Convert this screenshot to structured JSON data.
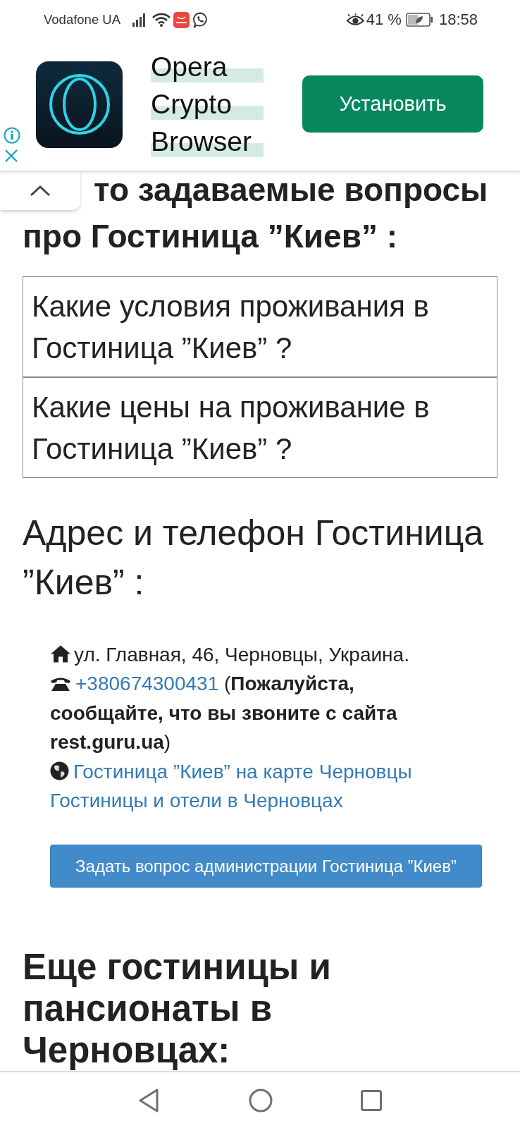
{
  "status_bar": {
    "carrier": "Vodafone UA",
    "battery": "41 %",
    "time": "18:58"
  },
  "ad": {
    "app_name": "Opera Crypto Browser",
    "install": "Установить"
  },
  "faq": {
    "heading_visible_part": "то задаваемые вопросы",
    "heading_rest": "про Гостиница ”Киев” :",
    "questions": [
      "Какие условия проживания в Гостиница ”Киев” ?",
      "Какие цены на проживание в Гостиница ”Киев” ?"
    ]
  },
  "contacts": {
    "heading": "Адрес и телефон Гостиница ”Киев” :",
    "address": "ул. Главная, 46, Черновцы, Украина.",
    "phone": "+380674300431",
    "phone_note": "(**Пожалуйста, сообщайте, что вы звоните с сайта rest.guru.ua**)",
    "map_link": "Гостиница ”Киев” на карте Черновцы",
    "city_link": "Гостиницы и отели в Черновцах",
    "ask_button": "Задать вопрос администрации Гостиница ”Киев”"
  },
  "more": {
    "heading": "Еще гостиницы и пансионаты в Черновцах:"
  }
}
